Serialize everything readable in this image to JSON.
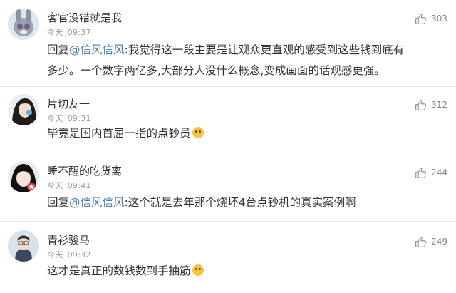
{
  "comments": [
    {
      "username": "客官没错就是我",
      "date": "今天",
      "time": "09:37",
      "likes": "303",
      "reply_prefix": "回复",
      "mention": "@信风信风",
      "text_line1": ":我觉得这一段主要是让观众更直观的感受到这些钱到底有",
      "text_line2": "多少。一个数字两亿多,大部分人没什么概念,变成画面的话观感更强。"
    },
    {
      "username": "片切友一",
      "date": "今天",
      "time": "09:31",
      "likes": "312",
      "text": "毕竟是国内首屈一指的点钞员",
      "emoji": "grin-emoji"
    },
    {
      "username": "睡不醒的吃货离",
      "date": "今天",
      "time": "09:41",
      "likes": "244",
      "reply_prefix": "回复",
      "mention": "@信风信风",
      "text": ":这个就是去年那个烧坏4台点钞机的真实案例啊"
    },
    {
      "username": "青衫骏马",
      "date": "今天",
      "time": "09:32",
      "likes": "249",
      "text": "这才是真正的数钱数到手抽筋",
      "emoji": "grin-emoji"
    }
  ],
  "icons": {
    "like": "thumbs-up-icon"
  },
  "colors": {
    "mention": "#4d7fae",
    "meta": "#999999",
    "divider": "#e6e6e6"
  }
}
